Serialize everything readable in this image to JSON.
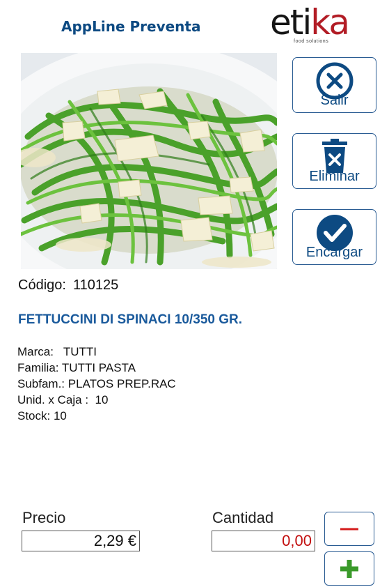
{
  "header": {
    "app_title": "AppLine Preventa",
    "logo": {
      "word_main": "eti",
      "word_accent": "ka",
      "tagline": "food solutions"
    }
  },
  "actions": {
    "salir_label": "Salir",
    "eliminar_label": "Eliminar",
    "encargar_label": "Encargar"
  },
  "product": {
    "codigo_label": "Código:",
    "codigo_value": "110125",
    "name": "FETTUCCINI DI SPINACI 10/350 GR.",
    "details": [
      "Marca:   TUTTI",
      "Familia: TUTTI PASTA",
      "Subfam.: PLATOS PREP.RAC",
      "Unid. x Caja :  10",
      "Stock: 10"
    ]
  },
  "order": {
    "precio_label": "Precio",
    "precio_value": "2,29 €",
    "cantidad_label": "Cantidad",
    "cantidad_value": "0,00",
    "minus_symbol": "−",
    "plus_symbol": "+"
  },
  "colors": {
    "brand_blue": "#0d4a82",
    "button_border": "#2a5c93",
    "quantity_red": "#c20e0e",
    "minus_red": "#d41c1c",
    "plus_green": "#3a9a2a",
    "logo_red": "#b21c25"
  },
  "icons": [
    "close-circle-icon",
    "trash-icon",
    "checkmark-circle-icon",
    "minus-icon",
    "plus-icon"
  ]
}
